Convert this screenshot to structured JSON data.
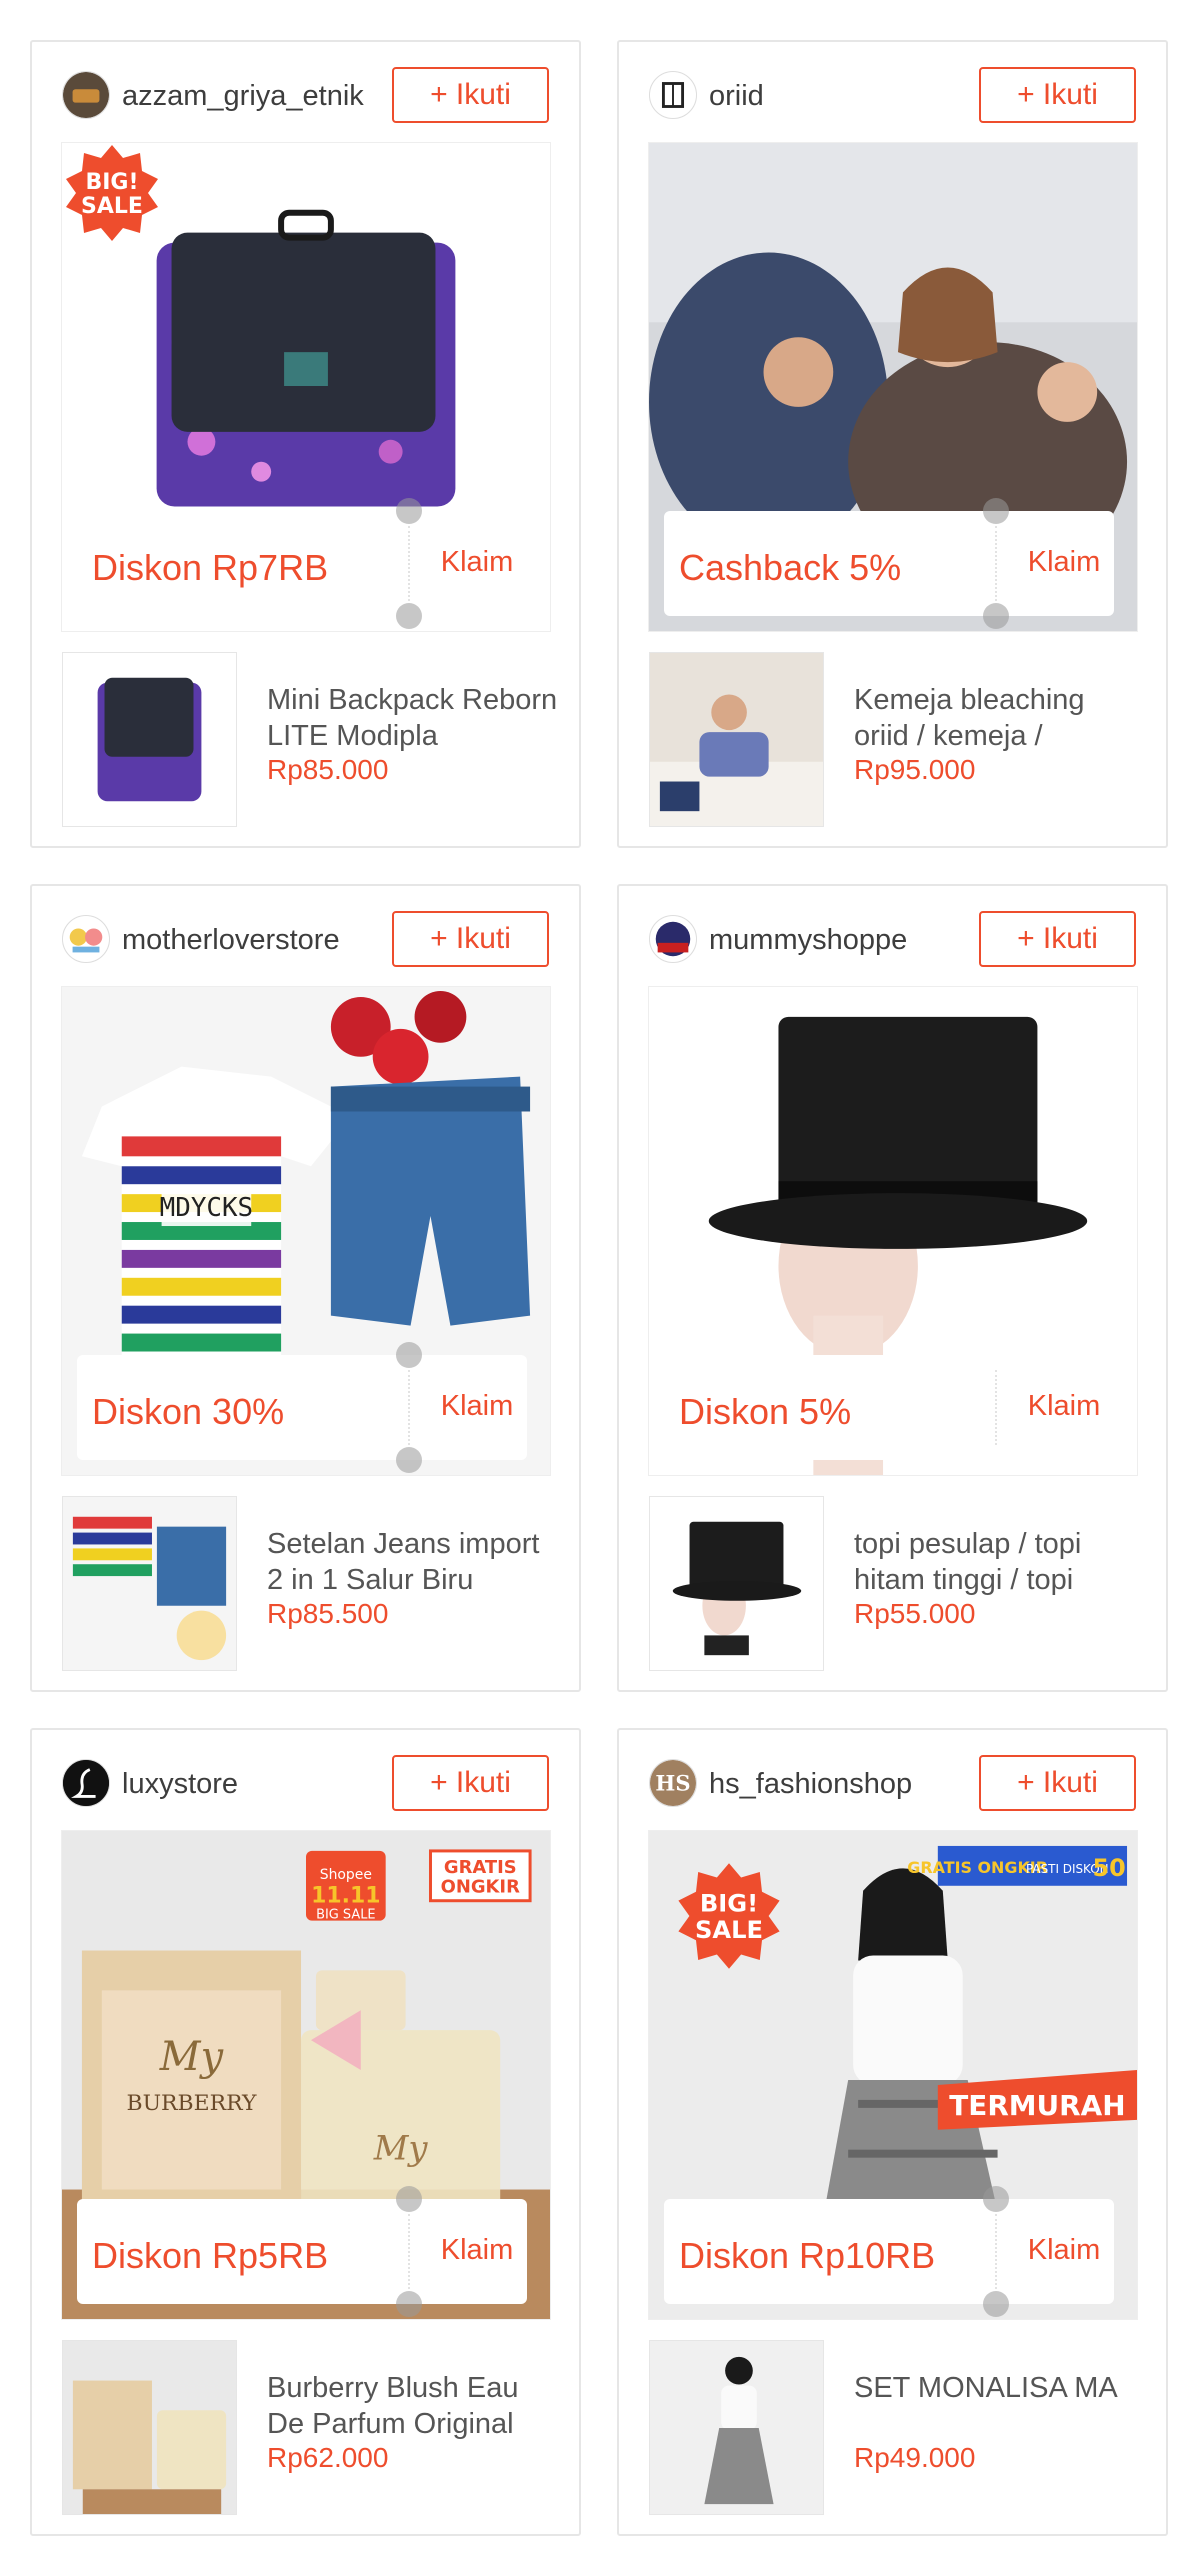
{
  "cards": [
    {
      "shop": "azzam_griya_etnik",
      "follow_label": "+ Ikuti",
      "voucher": "Diskon Rp7RB",
      "claim_label": "Klaim",
      "badge": "BIG! SALE",
      "product_name": "Mini Backpack Reborn LITE Modipla",
      "price": "Rp85.000"
    },
    {
      "shop": "oriid",
      "follow_label": "+ Ikuti",
      "voucher": "Cashback 5%",
      "claim_label": "Klaim",
      "product_name": "Kemeja bleaching oriid / kemeja /",
      "price": "Rp95.000"
    },
    {
      "shop": "motherloverstore",
      "follow_label": "+ Ikuti",
      "voucher": "Diskon 30%",
      "claim_label": "Klaim",
      "product_name": "Setelan Jeans import 2 in 1 Salur Biru",
      "price": "Rp85.500"
    },
    {
      "shop": "mummyshoppe",
      "follow_label": "+ Ikuti",
      "voucher": "Diskon 5%",
      "claim_label": "Klaim",
      "product_name": "topi pesulap / topi hitam tinggi / topi",
      "price": "Rp55.000"
    },
    {
      "shop": "luxystore",
      "follow_label": "+ Ikuti",
      "voucher": "Diskon Rp5RB",
      "claim_label": "Klaim",
      "hero_badges": [
        "Shopee",
        "11.11",
        "BIG SALE",
        "GRATIS",
        "ONGKIR"
      ],
      "product_name": "Burberry Blush Eau De Parfum Original",
      "price": "Rp62.000"
    },
    {
      "shop": "hs_fashionshop",
      "follow_label": "+ Ikuti",
      "voucher": "Diskon Rp10RB",
      "claim_label": "Klaim",
      "badge": "BIG! SALE",
      "hero_badges": [
        "TERMURAH",
        "GRATIS ONGKIR",
        "PASTI DISKON",
        "50"
      ],
      "product_name": "SET MONALISA MA",
      "price": "Rp49.000"
    }
  ],
  "colors": {
    "accent": "#ee4d2d",
    "border": "#e6e6e6"
  }
}
